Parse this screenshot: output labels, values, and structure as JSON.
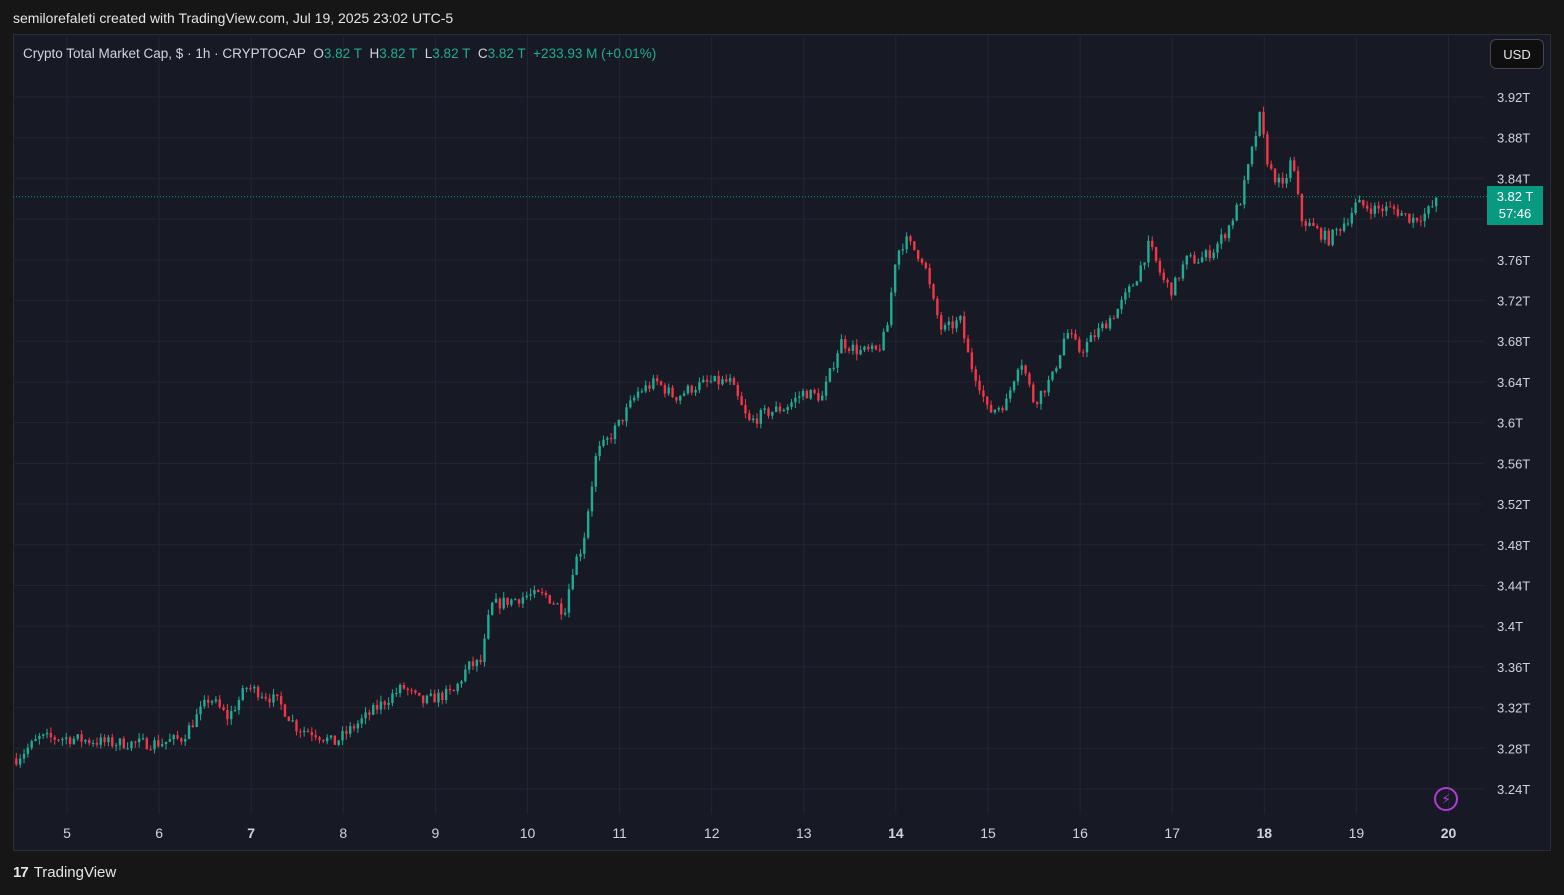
{
  "header": {
    "attribution": "semilorefaleti created with TradingView.com, Jul 19, 2025 23:02 UTC-5"
  },
  "legend": {
    "symbol": "Crypto Total Market Cap, $ · 1h · CRYPTOCAP",
    "o_label": "O",
    "o_value": "3.82 T",
    "h_label": "H",
    "h_value": "3.82 T",
    "l_label": "L",
    "l_value": "3.82 T",
    "c_label": "C",
    "c_value": "3.82 T",
    "change": "+233.93 M (+0.01%)"
  },
  "currency_button": "USD",
  "last_price": {
    "value": "3.82 T",
    "countdown": "57:46"
  },
  "brand": {
    "name": "TradingView",
    "logo_text": "17"
  },
  "icons": {
    "bolt": "lightning-icon"
  },
  "colors": {
    "up": "#22ab94",
    "down": "#f23645",
    "background": "#171a25",
    "grid": "#232632",
    "price_line": "#089981"
  },
  "chart_data": {
    "type": "candlestick",
    "title": "Crypto Total Market Cap",
    "interval": "1h",
    "ylim": [
      3.22,
      3.94
    ],
    "y_ticks": [
      "3.24T",
      "3.28T",
      "3.32T",
      "3.36T",
      "3.4T",
      "3.44T",
      "3.48T",
      "3.52T",
      "3.56T",
      "3.6T",
      "3.64T",
      "3.68T",
      "3.72T",
      "3.76T",
      "3.8T",
      "3.84T",
      "3.88T",
      "3.92T"
    ],
    "x_ticks": [
      "5",
      "6",
      "7",
      "8",
      "9",
      "10",
      "11",
      "12",
      "13",
      "14",
      "15",
      "16",
      "17",
      "18",
      "19",
      "20"
    ],
    "x_range_days": [
      4.4,
      20.05
    ],
    "close_series": [
      [
        4.45,
        3.27
      ],
      [
        4.7,
        3.29
      ],
      [
        5.0,
        3.29
      ],
      [
        5.5,
        3.285
      ],
      [
        6.0,
        3.285
      ],
      [
        6.25,
        3.29
      ],
      [
        6.4,
        3.31
      ],
      [
        6.55,
        3.33
      ],
      [
        6.75,
        3.31
      ],
      [
        6.95,
        3.34
      ],
      [
        7.1,
        3.335
      ],
      [
        7.3,
        3.325
      ],
      [
        7.5,
        3.3
      ],
      [
        7.7,
        3.295
      ],
      [
        7.9,
        3.285
      ],
      [
        8.1,
        3.3
      ],
      [
        8.3,
        3.315
      ],
      [
        8.5,
        3.33
      ],
      [
        8.65,
        3.34
      ],
      [
        8.85,
        3.325
      ],
      [
        9.0,
        3.33
      ],
      [
        9.2,
        3.335
      ],
      [
        9.35,
        3.36
      ],
      [
        9.5,
        3.365
      ],
      [
        9.6,
        3.42
      ],
      [
        9.8,
        3.425
      ],
      [
        10.0,
        3.43
      ],
      [
        10.2,
        3.43
      ],
      [
        10.4,
        3.415
      ],
      [
        10.5,
        3.46
      ],
      [
        10.6,
        3.48
      ],
      [
        10.75,
        3.57
      ],
      [
        10.85,
        3.58
      ],
      [
        11.0,
        3.6
      ],
      [
        11.2,
        3.63
      ],
      [
        11.4,
        3.64
      ],
      [
        11.6,
        3.625
      ],
      [
        11.8,
        3.635
      ],
      [
        12.0,
        3.64
      ],
      [
        12.2,
        3.64
      ],
      [
        12.4,
        3.6
      ],
      [
        12.6,
        3.61
      ],
      [
        12.8,
        3.615
      ],
      [
        13.0,
        3.63
      ],
      [
        13.2,
        3.625
      ],
      [
        13.4,
        3.68
      ],
      [
        13.6,
        3.67
      ],
      [
        13.8,
        3.67
      ],
      [
        13.9,
        3.69
      ],
      [
        14.0,
        3.765
      ],
      [
        14.1,
        3.78
      ],
      [
        14.3,
        3.76
      ],
      [
        14.4,
        3.72
      ],
      [
        14.5,
        3.69
      ],
      [
        14.7,
        3.7
      ],
      [
        14.8,
        3.66
      ],
      [
        14.9,
        3.64
      ],
      [
        15.0,
        3.61
      ],
      [
        15.2,
        3.62
      ],
      [
        15.35,
        3.665
      ],
      [
        15.5,
        3.62
      ],
      [
        15.7,
        3.645
      ],
      [
        15.85,
        3.69
      ],
      [
        16.0,
        3.67
      ],
      [
        16.2,
        3.69
      ],
      [
        16.4,
        3.71
      ],
      [
        16.6,
        3.74
      ],
      [
        16.75,
        3.775
      ],
      [
        16.9,
        3.74
      ],
      [
        17.0,
        3.73
      ],
      [
        17.15,
        3.76
      ],
      [
        17.3,
        3.76
      ],
      [
        17.45,
        3.77
      ],
      [
        17.6,
        3.79
      ],
      [
        17.75,
        3.82
      ],
      [
        17.85,
        3.86
      ],
      [
        17.95,
        3.9
      ],
      [
        18.05,
        3.85
      ],
      [
        18.2,
        3.83
      ],
      [
        18.3,
        3.86
      ],
      [
        18.4,
        3.8
      ],
      [
        18.55,
        3.79
      ],
      [
        18.7,
        3.78
      ],
      [
        18.9,
        3.8
      ],
      [
        19.0,
        3.815
      ],
      [
        19.2,
        3.81
      ],
      [
        19.4,
        3.81
      ],
      [
        19.6,
        3.8
      ],
      [
        19.75,
        3.805
      ],
      [
        19.9,
        3.82
      ]
    ],
    "last_value": 3.82,
    "grid": true
  }
}
